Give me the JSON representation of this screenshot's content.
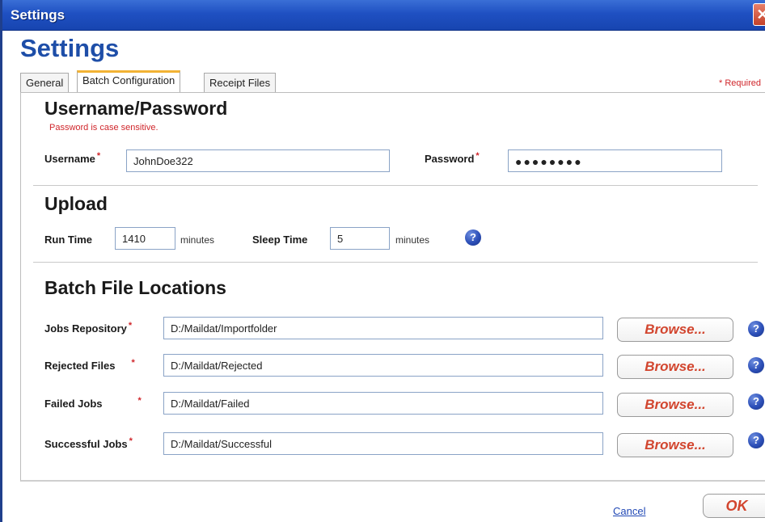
{
  "window": {
    "title": "Settings",
    "close_glyph": "✕"
  },
  "page": {
    "title": "Settings"
  },
  "tabs": [
    {
      "label": "General",
      "active": false
    },
    {
      "label": "Batch Configuration",
      "active": true
    },
    {
      "label": "Receipt Files",
      "active": false
    }
  ],
  "required_note": "* Required",
  "credentials": {
    "heading": "Username/Password",
    "hint": "Password is case sensitive.",
    "username_label": "Username",
    "username_value": "JohnDoe322",
    "password_label": "Password",
    "password_value": "●●●●●●●●"
  },
  "upload": {
    "heading": "Upload",
    "run_time_label": "Run Time",
    "run_time_value": "1410",
    "run_time_unit": "minutes",
    "sleep_time_label": "Sleep Time",
    "sleep_time_value": "5",
    "sleep_time_unit": "minutes"
  },
  "locations": {
    "heading": "Batch File Locations",
    "browse_label": "Browse...",
    "rows": [
      {
        "label": "Jobs Repository",
        "value": "D:/Maildat/Importfolder"
      },
      {
        "label": "Rejected Files",
        "value": "D:/Maildat/Rejected"
      },
      {
        "label": "Failed Jobs",
        "value": "D:/Maildat/Failed"
      },
      {
        "label": "Successful Jobs",
        "value": "D:/Maildat/Successful"
      }
    ]
  },
  "footer": {
    "cancel_label": "Cancel",
    "ok_label": "OK"
  },
  "required_marker": "*",
  "help_glyph": "?",
  "icons": {
    "help": "help-icon",
    "close": "close-icon"
  },
  "colors": {
    "title_blue": "#1e4ea8",
    "titlebar": "#1f50c2",
    "required_red": "#d0262b",
    "button_text": "#d2452e",
    "tab_accent": "#f2b334"
  }
}
